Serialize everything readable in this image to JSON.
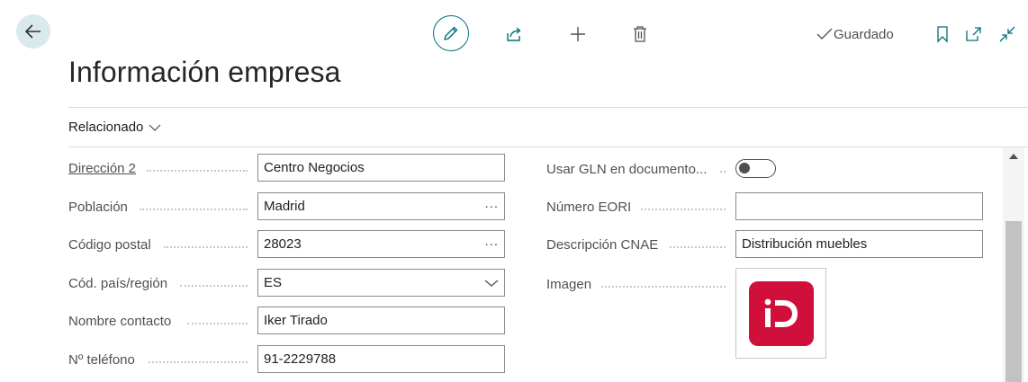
{
  "toolbar": {
    "saved_label": "Guardado"
  },
  "page": {
    "title": "Información empresa",
    "related_label": "Relacionado"
  },
  "left_fields": [
    {
      "label": "Dirección 2",
      "value": "Centro Negocios"
    },
    {
      "label": "Población",
      "value": "Madrid"
    },
    {
      "label": "Código postal",
      "value": "28023"
    },
    {
      "label": "Cód. país/región",
      "value": "ES"
    },
    {
      "label": "Nombre contacto",
      "value": "Iker Tirado"
    },
    {
      "label": "Nº teléfono",
      "value": "91-2229788"
    }
  ],
  "right_fields": [
    {
      "label": "Usar GLN en documento...",
      "value": ""
    },
    {
      "label": "Número EORI",
      "value": ""
    },
    {
      "label": "Descripción CNAE",
      "value": "Distribución muebles"
    },
    {
      "label": "Imagen",
      "value": ""
    }
  ],
  "toggle": {
    "on": false
  },
  "colors": {
    "accent": "#00707a",
    "logo": "#d0103a",
    "back_bg": "#d8eaee"
  },
  "icons": [
    "back-arrow-icon",
    "pencil-icon",
    "share-icon",
    "plus-icon",
    "trash-icon",
    "check-icon",
    "bookmark-icon",
    "open-new-window-icon",
    "collapse-icon",
    "chevron-down-icon",
    "ellipsis-icon"
  ]
}
